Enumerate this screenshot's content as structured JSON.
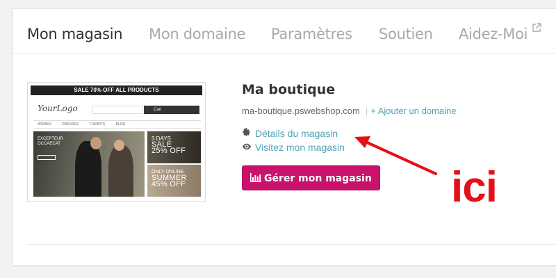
{
  "tabs": [
    {
      "label": "Mon magasin",
      "active": true
    },
    {
      "label": "Mon domaine",
      "active": false
    },
    {
      "label": "Paramètres",
      "active": false
    },
    {
      "label": "Soutien",
      "active": false
    },
    {
      "label": "Aidez-Moi",
      "active": false,
      "icon": "external-link-icon"
    }
  ],
  "preview": {
    "banner": "SALE 70% OFF ALL PRODUCTS",
    "logo": "YourLogo",
    "cart": "Cart",
    "nav": [
      "WOMEN",
      "DRESSES",
      "T-SHIRTS",
      "BLOG"
    ],
    "hero": [
      "EXCEPTEUR",
      "OCCAECAT"
    ],
    "promo1": {
      "small": "3 DAYS",
      "big": "SALE",
      "pct": "25% OFF"
    },
    "promo2": {
      "small": "ONLY ONLINE",
      "big": "SUMMER",
      "pct": "45% OFF"
    }
  },
  "shop": {
    "name": "Ma boutique",
    "domain": "ma-boutique.pswebshop.com",
    "add_domain": "+ Ajouter un domaine",
    "details_link": "Détails du magasin",
    "details_icon": "gear-icon",
    "visit_link": "Visitez mon magasin",
    "visit_icon": "eye-icon",
    "manage_button": "Gérer mon magasin",
    "manage_icon": "bar-chart-icon"
  },
  "annotation": {
    "text": "ici",
    "color": "#e50f18"
  },
  "colors": {
    "accent": "#c9126b",
    "link": "#4fa4b8"
  }
}
